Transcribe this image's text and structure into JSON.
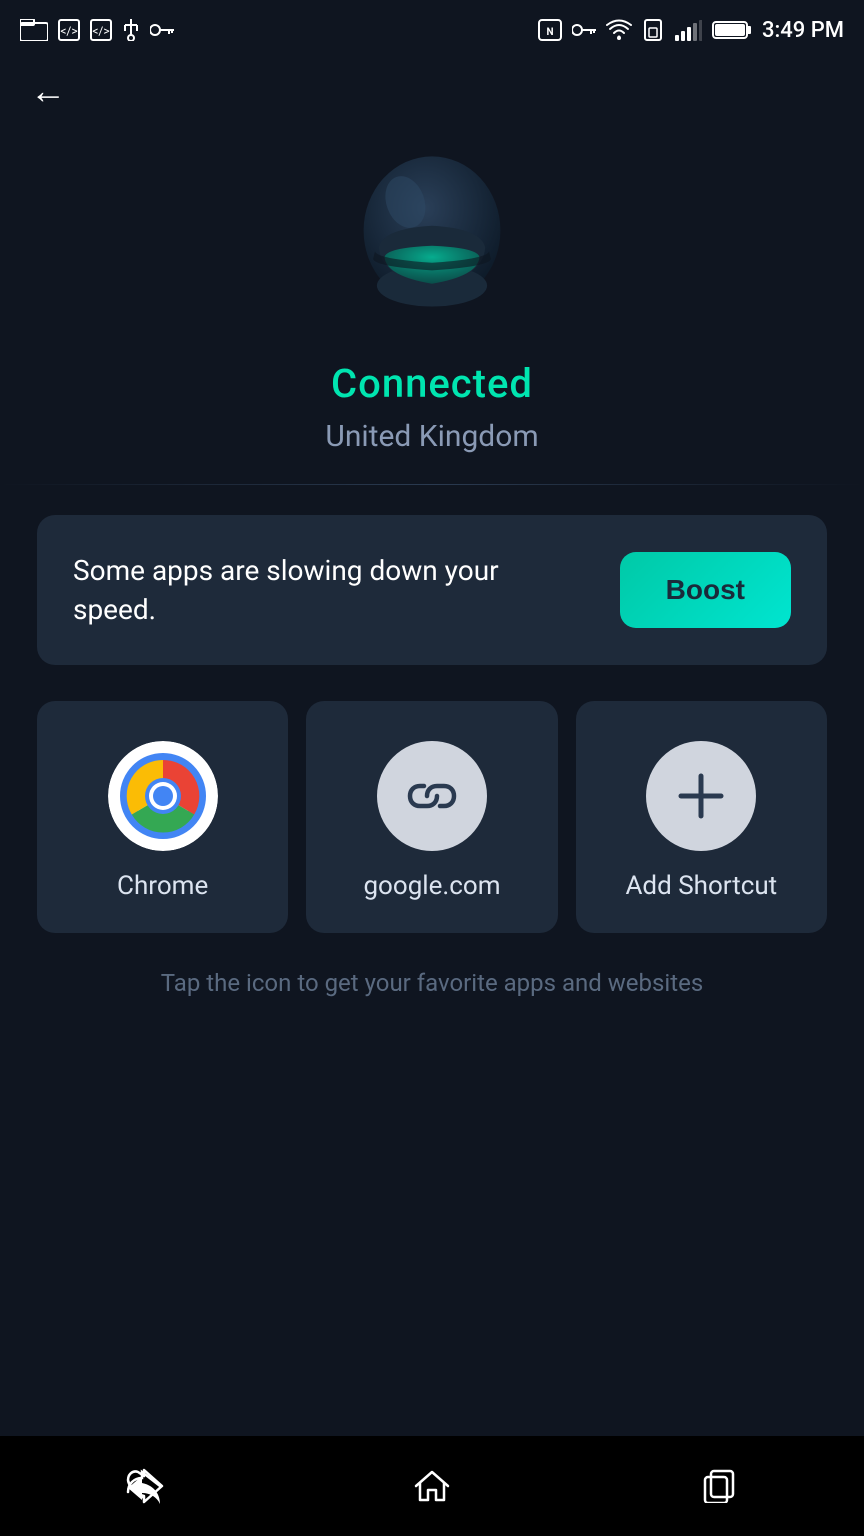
{
  "statusBar": {
    "time": "3:49 PM",
    "icons": [
      "screenshot",
      "code",
      "code2",
      "usb",
      "key",
      "nfc",
      "vpn-key",
      "wifi",
      "sim",
      "signal",
      "battery"
    ]
  },
  "navigation": {
    "backLabel": "←"
  },
  "hero": {
    "status": "Connected",
    "location": "United Kingdom"
  },
  "boostCard": {
    "message": "Some apps are slowing down your speed.",
    "buttonLabel": "Boost"
  },
  "shortcuts": [
    {
      "id": "chrome",
      "label": "Chrome",
      "iconType": "chrome"
    },
    {
      "id": "google",
      "label": "google.com",
      "iconType": "link"
    },
    {
      "id": "add",
      "label": "Add Shortcut",
      "iconType": "add"
    }
  ],
  "hint": "Tap the icon to get your favorite apps and websites",
  "navBar": {
    "backLabel": "↩",
    "homeLabel": "⌂",
    "recentLabel": "⧉"
  }
}
